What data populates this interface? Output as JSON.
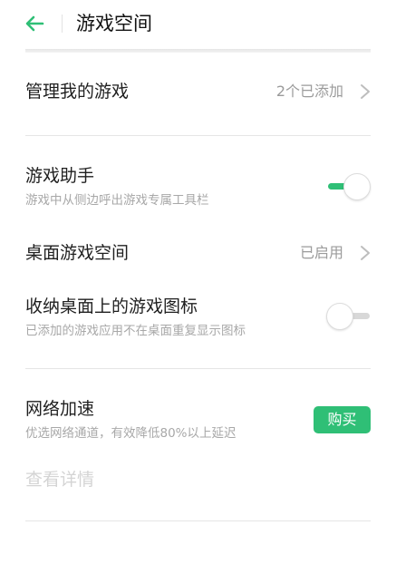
{
  "header": {
    "title": "游戏空间",
    "back_icon": "back-arrow-icon",
    "accent_color": "#2fbf76"
  },
  "items": {
    "manage": {
      "title": "管理我的游戏",
      "value": "2个已添加"
    },
    "assistant": {
      "title": "游戏助手",
      "subtitle": "游戏中从侧边呼出游戏专属工具栏",
      "enabled": true
    },
    "desktop_space": {
      "title": "桌面游戏空间",
      "value": "已启用"
    },
    "store_icons": {
      "title": "收纳桌面上的游戏图标",
      "subtitle": "已添加的游戏应用不在桌面重复显示图标",
      "enabled": false
    },
    "network": {
      "title": "网络加速",
      "subtitle": "优选网络通道，有效降低80%以上延迟",
      "button": "购买",
      "detail_link": "查看详情"
    }
  },
  "icons": {
    "chevron": "chevron-right-icon"
  },
  "colors": {
    "accent": "#2fbf76",
    "secondary_text": "#a8a8a8",
    "disabled_text": "#d4d4d4"
  }
}
